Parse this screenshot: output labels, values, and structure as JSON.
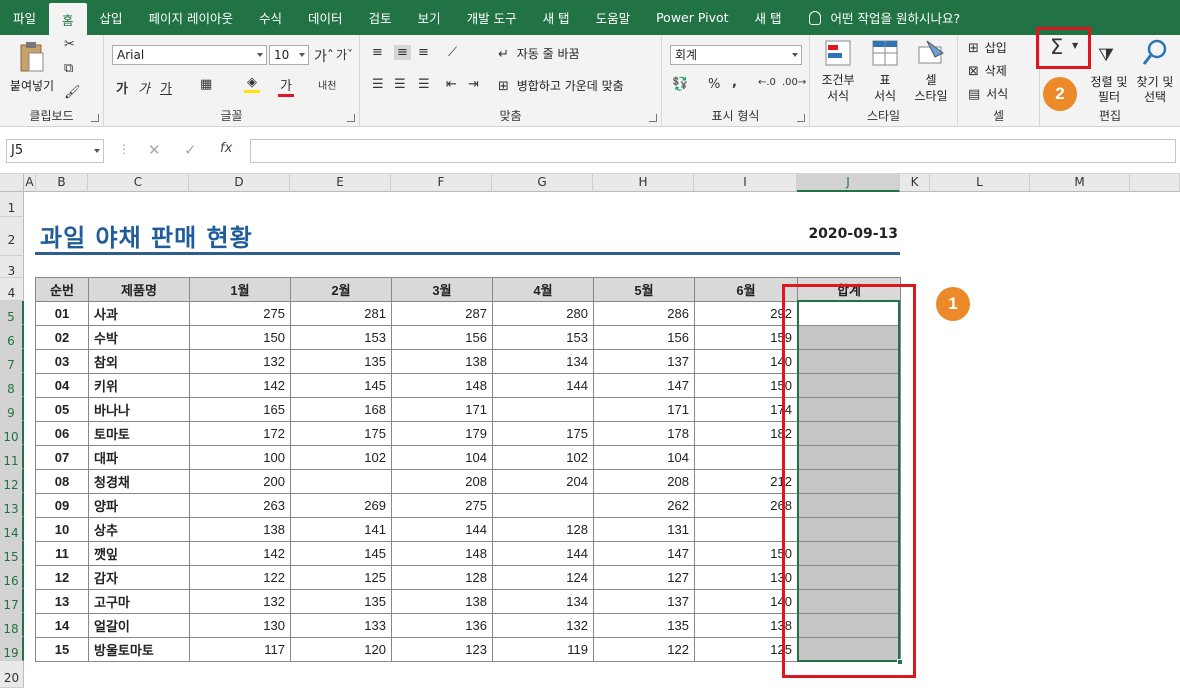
{
  "tabs": [
    "파일",
    "홈",
    "삽입",
    "페이지 레이아웃",
    "수식",
    "데이터",
    "검토",
    "보기",
    "개발 도구",
    "새 탭",
    "도움말",
    "Power Pivot",
    "새 탭"
  ],
  "active_tab": 1,
  "tell_me": "어떤 작업을 원하시나요?",
  "ribbon": {
    "clipboard": {
      "paste_label": "붙여넣기",
      "group": "클립보드"
    },
    "font": {
      "name": "Arial",
      "size": "10",
      "group": "글꼴",
      "bold": "가",
      "italic": "가",
      "underline": "가",
      "sep_label": "내천"
    },
    "alignment": {
      "wrap": "자동 줄 바꿈",
      "merge": "병합하고 가운데 맞춤",
      "group": "맞춤"
    },
    "number": {
      "format": "회계",
      "percent": "%",
      "comma": ",",
      "group": "표시 형식"
    },
    "styles": {
      "cond": "조건부\n서식",
      "cond1": "조건부",
      "cond2": "서식",
      "table1": "표",
      "table2": "서식",
      "cell1": "셀",
      "cell2": "스타일",
      "group": "스타일"
    },
    "cells": {
      "insert": "삽입",
      "delete": "삭제",
      "format": "서식",
      "group": "셀"
    },
    "editing": {
      "sigma": "Σ",
      "sort1": "정렬 및",
      "sort2": "필터",
      "find1": "찾기 및",
      "find2": "선택",
      "group": "편집"
    }
  },
  "formula_bar": {
    "name_box": "J5",
    "fx": "fx",
    "value": ""
  },
  "columns": [
    "A",
    "B",
    "C",
    "D",
    "E",
    "F",
    "G",
    "H",
    "I",
    "J",
    "K",
    "L",
    "M"
  ],
  "selected_column": "J",
  "rows": [
    "1",
    "2",
    "3",
    "4",
    "5",
    "6",
    "7",
    "8",
    "9",
    "10",
    "11",
    "12",
    "13",
    "14",
    "15",
    "16",
    "17",
    "18",
    "19",
    "20"
  ],
  "sheet": {
    "title": "과일 야채 판매 현황",
    "date": "2020-09-13",
    "headers": [
      "순번",
      "제품명",
      "1월",
      "2월",
      "3월",
      "4월",
      "5월",
      "6월",
      "합계"
    ],
    "data": [
      [
        "01",
        "사과",
        "275",
        "281",
        "287",
        "280",
        "286",
        "292"
      ],
      [
        "02",
        "수박",
        "150",
        "153",
        "156",
        "153",
        "156",
        "159"
      ],
      [
        "03",
        "참외",
        "132",
        "135",
        "138",
        "134",
        "137",
        "140"
      ],
      [
        "04",
        "키위",
        "142",
        "145",
        "148",
        "144",
        "147",
        "150"
      ],
      [
        "05",
        "바나나",
        "165",
        "168",
        "171",
        "",
        "171",
        "174"
      ],
      [
        "06",
        "토마토",
        "172",
        "175",
        "179",
        "175",
        "178",
        "182"
      ],
      [
        "07",
        "대파",
        "100",
        "102",
        "104",
        "102",
        "104",
        ""
      ],
      [
        "08",
        "청경채",
        "200",
        "",
        "208",
        "204",
        "208",
        "212"
      ],
      [
        "09",
        "양파",
        "263",
        "269",
        "275",
        "",
        "262",
        "268"
      ],
      [
        "10",
        "상추",
        "138",
        "141",
        "144",
        "128",
        "131",
        ""
      ],
      [
        "11",
        "깻잎",
        "142",
        "145",
        "148",
        "144",
        "147",
        "150"
      ],
      [
        "12",
        "감자",
        "122",
        "125",
        "128",
        "124",
        "127",
        "130"
      ],
      [
        "13",
        "고구마",
        "132",
        "135",
        "138",
        "134",
        "137",
        "140"
      ],
      [
        "14",
        "얼갈이",
        "130",
        "133",
        "136",
        "132",
        "135",
        "138"
      ],
      [
        "15",
        "방울토마토",
        "117",
        "120",
        "123",
        "119",
        "122",
        "125"
      ]
    ]
  },
  "annotations": {
    "badge1": "1",
    "badge2": "2"
  },
  "colors": {
    "brand": "#217346",
    "title": "#1f5c99",
    "highlight": "#e0161f",
    "badge": "#ec8a2a"
  }
}
